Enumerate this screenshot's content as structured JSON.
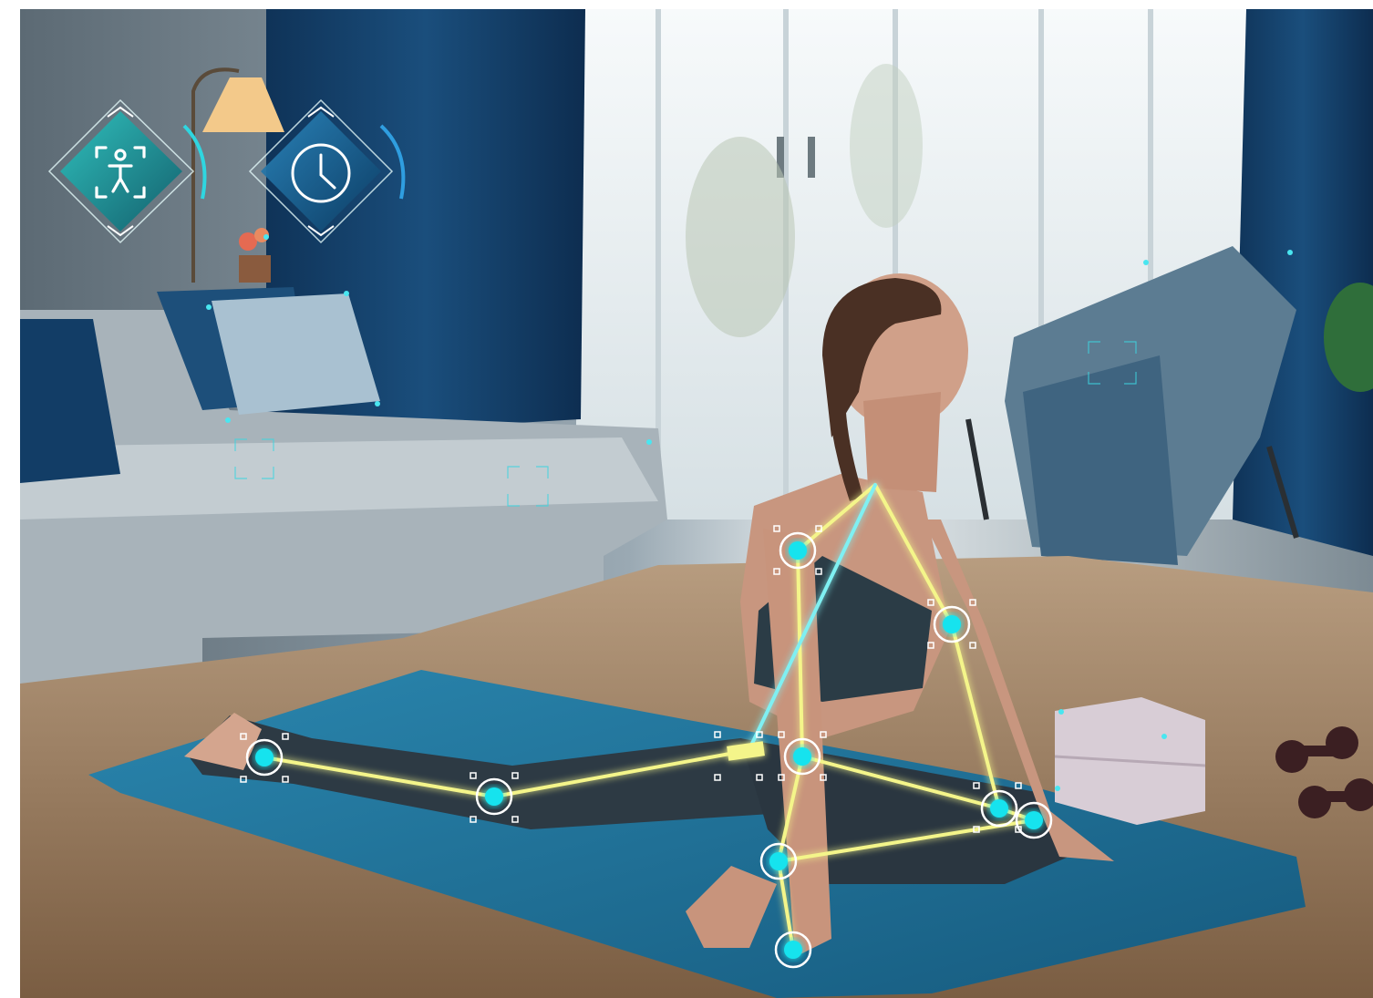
{
  "scene": {
    "description_icons": [
      "body-scan-icon",
      "clock-icon"
    ],
    "colors": {
      "skeleton_line": "#f4f58a",
      "skeleton_accent": "#7ff0f2",
      "joint_fill": "#17e3ee",
      "joint_ring": "#ffffff",
      "mat": "#1e6c92",
      "floor": "#9a7d5e",
      "curtain": "#123d66",
      "sofa": "#b8c2c8",
      "hud_teal": "#1fb3b5",
      "hud_blue": "#1a6fa0"
    }
  },
  "hud": {
    "buttons": [
      {
        "id": "body-scan",
        "icon": "body-scan-icon"
      },
      {
        "id": "timer",
        "icon": "clock-icon"
      }
    ]
  }
}
